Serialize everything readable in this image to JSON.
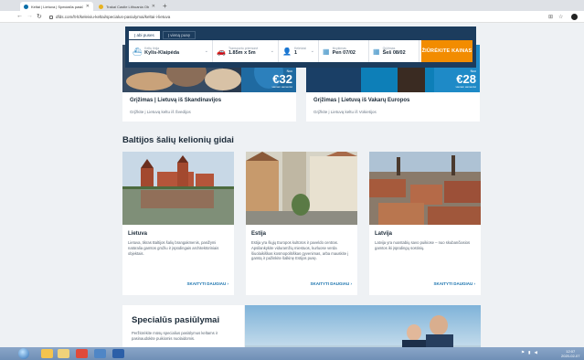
{
  "browser": {
    "tabs": [
      {
        "title": "Keltai | Lietuva | Specialūs pasiū...",
        "active": true
      },
      {
        "title": "Trakai Castle Lithuania Obrazy...",
        "active": false
      }
    ],
    "url": "dfds.com/lt-lt/keleiviu-keltai/specialus-pasiulymai/keltai-i-lietuva"
  },
  "search": {
    "tabs": [
      "Į abi puses",
      "Į vieną pusę"
    ],
    "route_label": "Keltų linija",
    "route_value": "Kylis-Klaipėda",
    "vehicle_label": "Transporto priemonė",
    "vehicle_value": "1.85m x 5m",
    "pax_label": "Keleiviai",
    "pax_value": "1",
    "out_label": "Išvykimas",
    "out_value": "Pen 07/02",
    "ret_label": "Grįžimas",
    "ret_value": "Šeš 08/02",
    "button": "ŽIŪRĖKITE KAINAS"
  },
  "promos": [
    {
      "price_prefix": "Nuo",
      "price": "€32",
      "price_note": "vienam asmeniui",
      "title": "Grįžimas | Lietuvą iš Skandinavijos",
      "subtitle": "Grįžkite į Lietuvą keltu iš Švedijos"
    },
    {
      "price_prefix": "Nuo",
      "price": "€28",
      "price_note": "vienam asmeniui",
      "title": "Grįžimas | Lietuvą iš Vakarų Europos",
      "subtitle": "Grįžkite į Lietuvą keltu iš Vokietijos"
    }
  ],
  "guides_heading": "Baltijos šalių kelionių gidai",
  "guides": [
    {
      "title": "Lietuva",
      "desc": "Lietuva, tikras Baltijos šalių brangakmenis, pasižymi natūralia gamtos grožiu ir įspūdingais architektūriniais objektais.",
      "link": "SKAITYTI DAUGIAU"
    },
    {
      "title": "Estija",
      "desc": "Estija yra šiųjų Europos kultūros ir paveldo centras. Apsilankykite viduramžių miestuos, kurluose verda šiuolaikiškas kosmopolitiškas gyvenimas, arba mauskite į gamtą ir pažinkite šalkinę Estijos pusę.",
      "link": "SKAITYTI DAUGIAU"
    },
    {
      "title": "Latvija",
      "desc": "Latvija yra nuostabių savo puikiose – nuo skubančiasios gamtos iki įspūdingų sostinių.",
      "link": "SKAITYTI DAUGIAU"
    }
  ],
  "special": {
    "title": "Specialūs pasiūlymai",
    "desc": "Peržiūrėkite mūsų specialius pasiūlymus keltams ir pasinaudokite puikiomis nuolaidomis."
  },
  "taskbar": {
    "time": "12:07",
    "date": "2020-02-07"
  }
}
